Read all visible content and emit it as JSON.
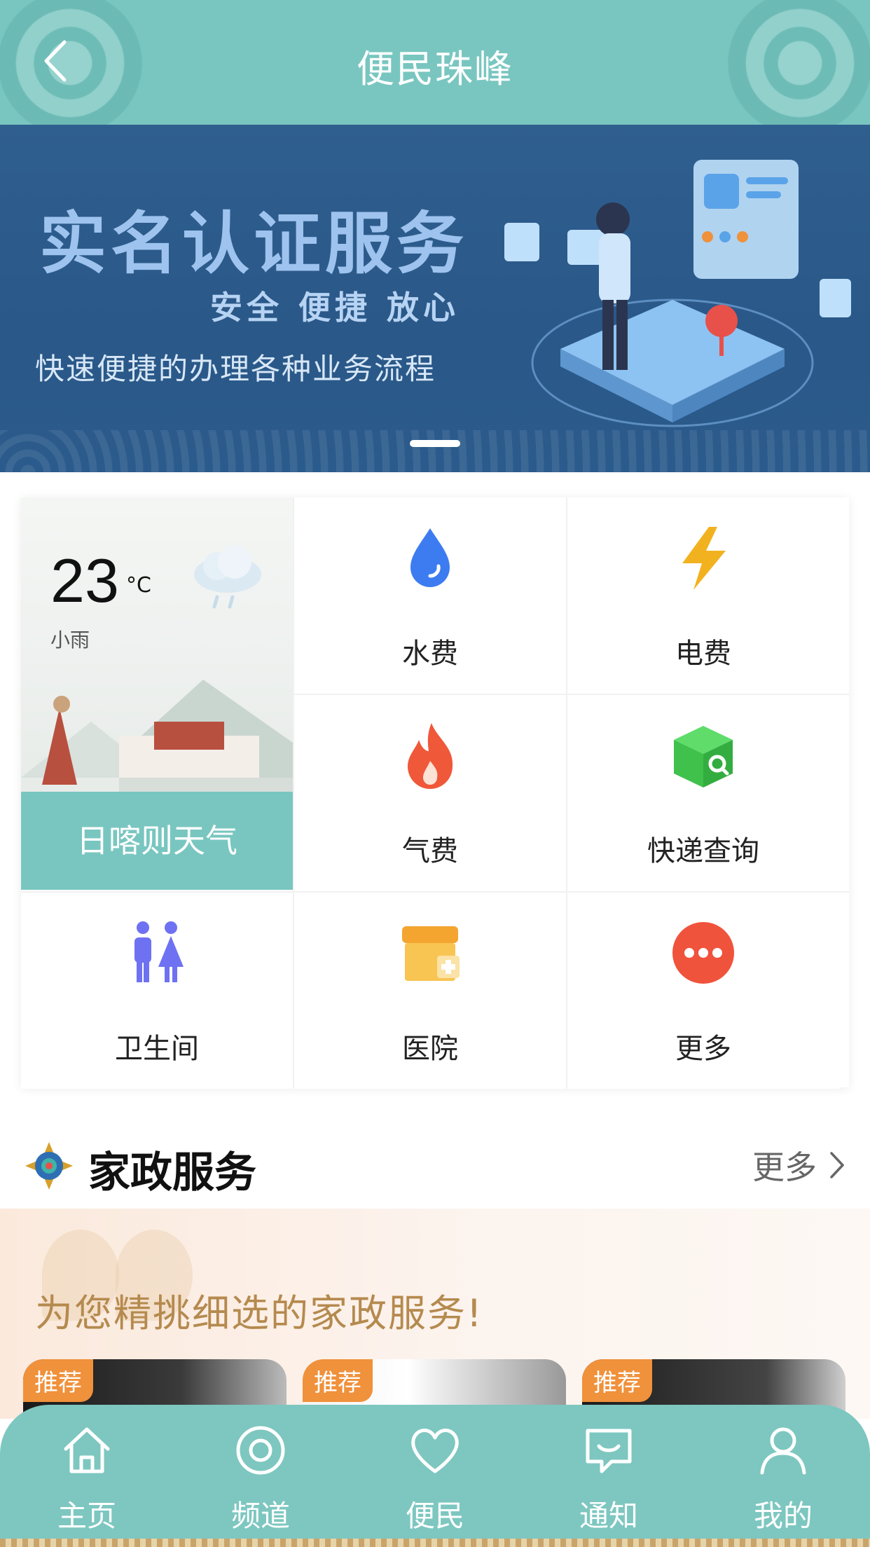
{
  "header": {
    "title": "便民珠峰"
  },
  "banner": {
    "title": "实名认证服务",
    "subtitle": "安全  便捷  放心",
    "description": "快速便捷的办理各种业务流程"
  },
  "weather": {
    "temperature": "23",
    "unit": "°C",
    "condition": "小雨",
    "city_label": "日喀则天气"
  },
  "services": {
    "water": "水费",
    "electricity": "电费",
    "gas": "气费",
    "express": "快递查询",
    "toilet": "卫生间",
    "hospital": "医院",
    "more": "更多"
  },
  "section": {
    "title": "家政服务",
    "more": "更多"
  },
  "promo": {
    "text": "为您精挑细选的家政服务!"
  },
  "cards": {
    "tag": "推荐"
  },
  "tabs": {
    "home": "主页",
    "channel": "频道",
    "convenience": "便民",
    "notice": "通知",
    "mine": "我的"
  },
  "colors": {
    "teal": "#79c6c0",
    "banner_blue": "#2f5f8f",
    "tag_orange": "#f0913b"
  }
}
